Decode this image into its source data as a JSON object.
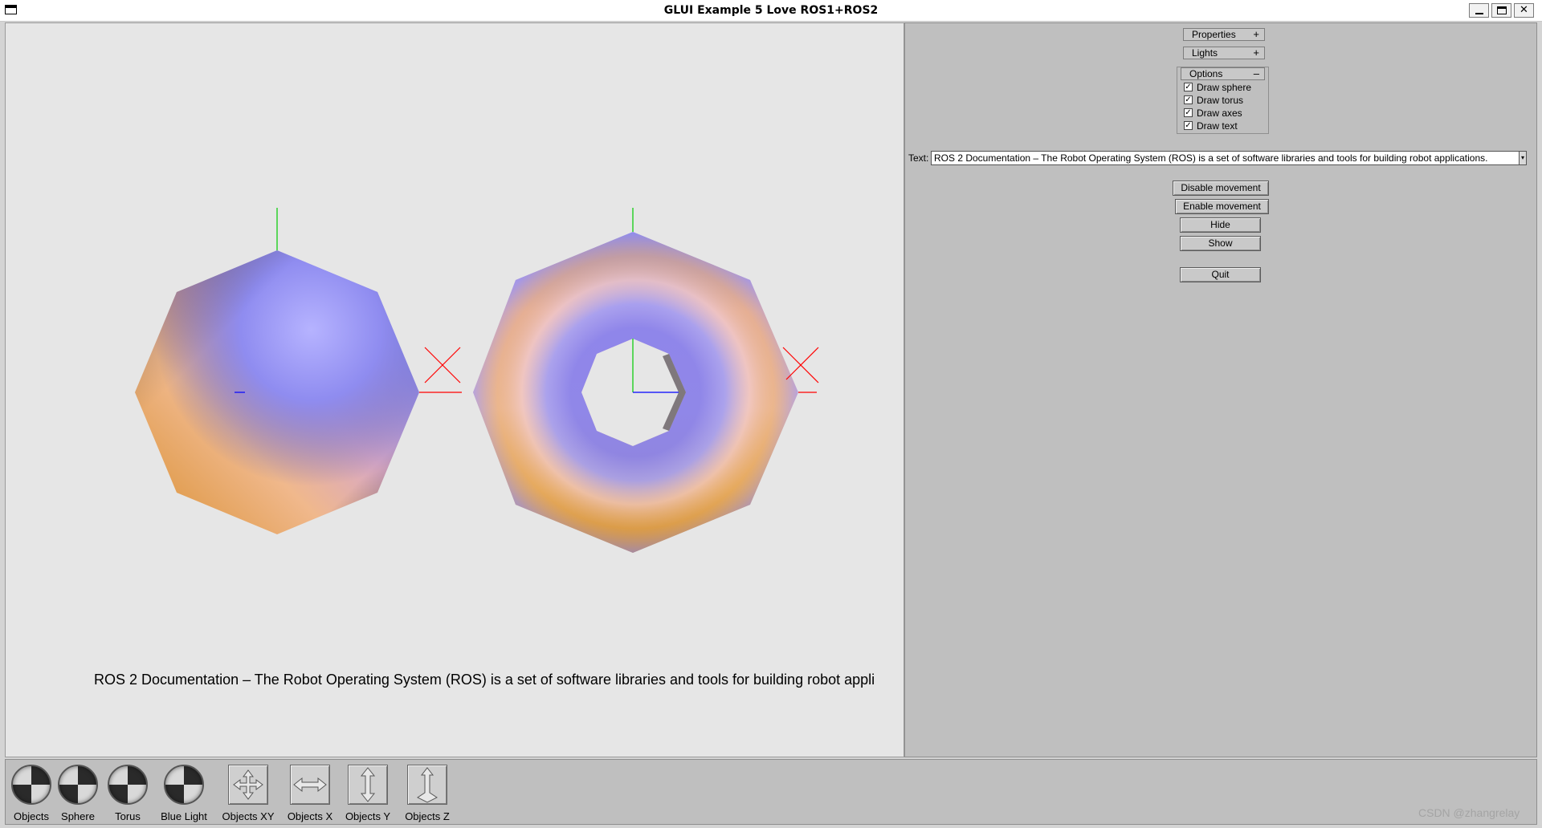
{
  "window": {
    "title": "GLUI Example 5 Love ROS1+ROS2",
    "min_glyph": "_",
    "max_glyph": "□",
    "close_glyph": "✕"
  },
  "viewport": {
    "overlay_text": "ROS 2 Documentation – The Robot Operating System (ROS) is a set of software libraries and tools for building robot appli"
  },
  "panel": {
    "properties": {
      "label": "Properties",
      "sign": "+"
    },
    "lights": {
      "label": "Lights",
      "sign": "+"
    },
    "options": {
      "label": "Options",
      "sign": "–",
      "checkboxes": [
        {
          "label": "Draw sphere",
          "checked": true
        },
        {
          "label": "Draw torus",
          "checked": true
        },
        {
          "label": "Draw axes",
          "checked": true
        },
        {
          "label": "Draw text",
          "checked": true
        }
      ]
    },
    "text_field": {
      "label": "Text:",
      "value": "ROS 2 Documentation – The Robot Operating System (ROS) is a set of software libraries and tools for building robot applications."
    },
    "buttons": {
      "disable_movement": "Disable movement",
      "enable_movement": "Enable movement",
      "hide": "Hide",
      "show": "Show",
      "quit": "Quit"
    }
  },
  "toolbar": {
    "items": [
      {
        "label": "Objects",
        "icon": "rotation-ball-icon"
      },
      {
        "label": "Sphere",
        "icon": "rotation-ball-icon"
      },
      {
        "label": "Torus",
        "icon": "rotation-ball-icon"
      },
      {
        "label": "Blue Light",
        "icon": "rotation-ball-icon"
      },
      {
        "label": "Objects XY",
        "icon": "move-xy-icon"
      },
      {
        "label": "Objects X",
        "icon": "move-x-icon"
      },
      {
        "label": "Objects Y",
        "icon": "move-y-icon"
      },
      {
        "label": "Objects Z",
        "icon": "move-z-icon"
      }
    ]
  },
  "watermark": "CSDN @zhangrelay",
  "colors": {
    "viewport_bg": "#e6e6e6",
    "panel_bg": "#bfbfbf",
    "axis_x": "#ff0000",
    "axis_y": "#00cc00",
    "axis_z": "#0000ff",
    "shade_blue": "#8f8cf0",
    "shade_orange": "#e0a24a",
    "shade_pink": "#f0c7c0"
  }
}
